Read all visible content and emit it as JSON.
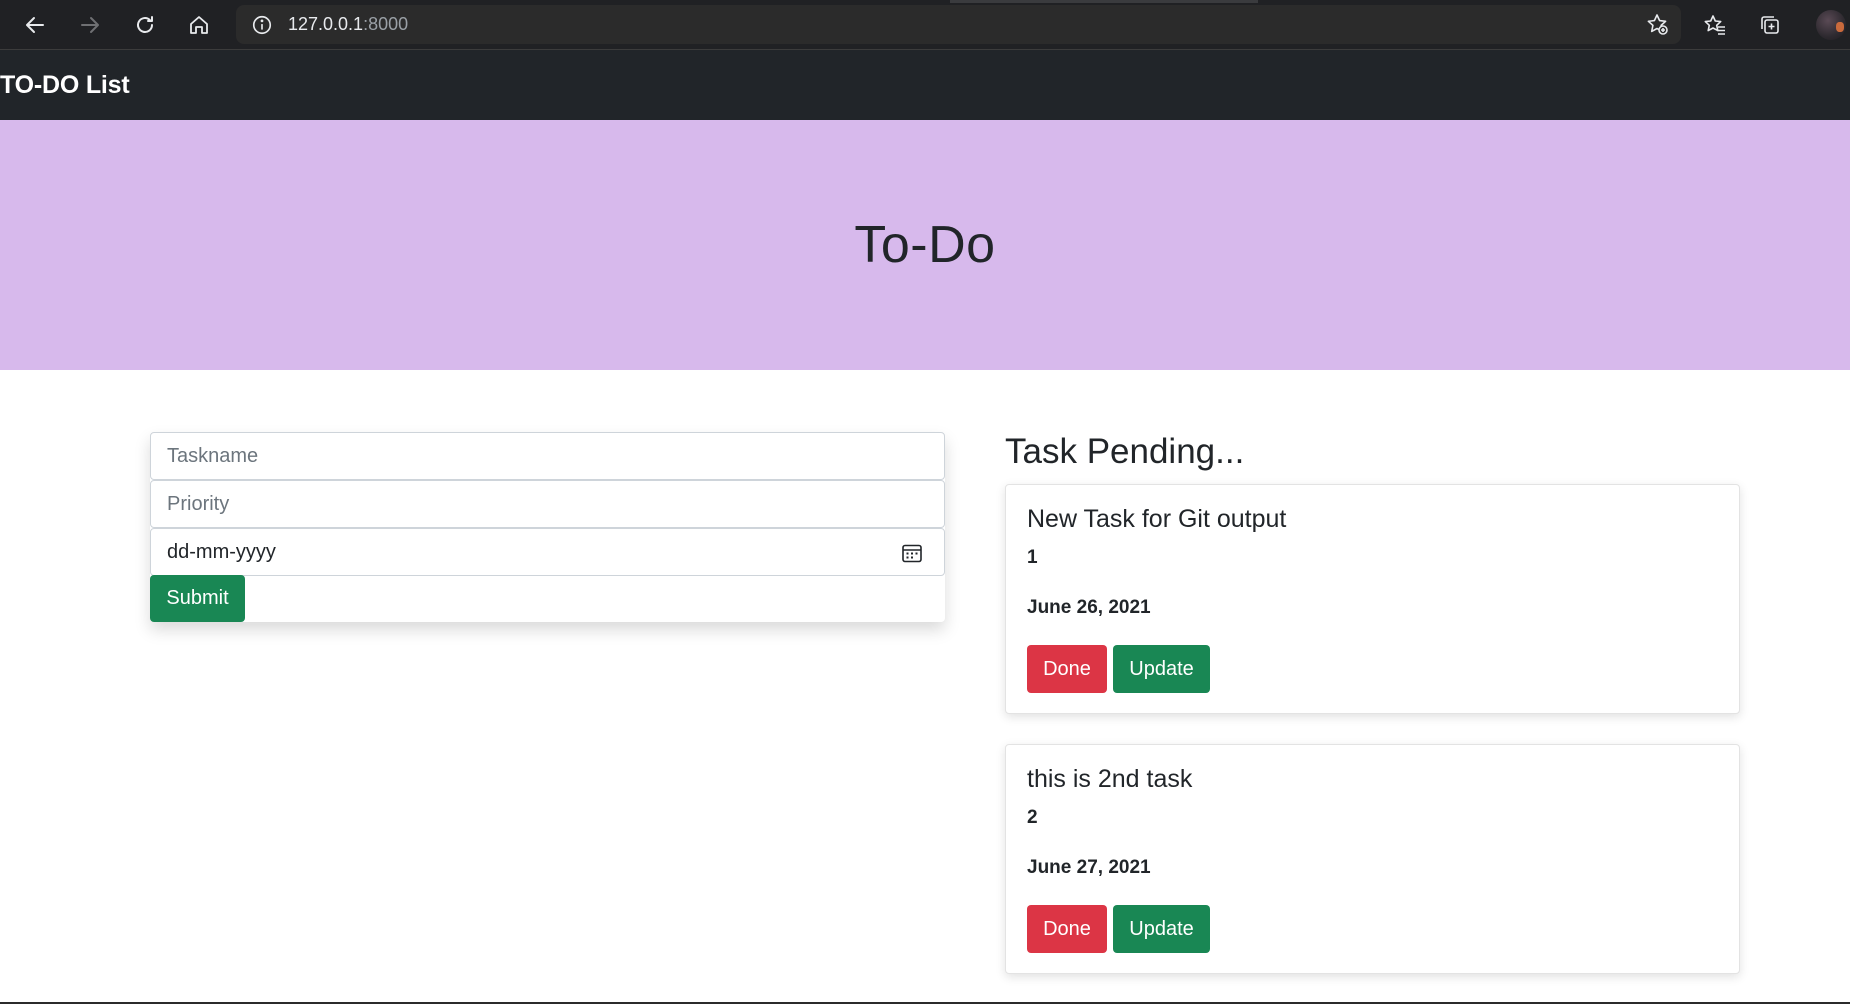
{
  "browser": {
    "url_host": "127.0.0.1",
    "url_port": ":8000"
  },
  "navbar": {
    "brand": "TO-DO List"
  },
  "hero": {
    "title": "To-Do"
  },
  "form": {
    "taskname_placeholder": "Taskname",
    "priority_placeholder": "Priority",
    "date_value": "dd-mm-yyyy",
    "submit_label": "Submit"
  },
  "tasks": {
    "heading": "Task Pending...",
    "items": [
      {
        "name": "New Task for Git output",
        "priority": "1",
        "date": "June 26, 2021",
        "done_label": "Done",
        "update_label": "Update"
      },
      {
        "name": "this is 2nd task",
        "priority": "2",
        "date": "June 27, 2021",
        "done_label": "Done",
        "update_label": "Update"
      }
    ]
  },
  "colors": {
    "navbar_bg": "#212529",
    "hero_bg": "#d7b9ec",
    "success": "#198754",
    "danger": "#dc3545"
  },
  "icons": {
    "back": "arrow-left-icon",
    "forward": "arrow-right-icon",
    "reload": "reload-icon",
    "home": "home-icon",
    "site_info": "info-icon",
    "add_favorite": "star-add-icon",
    "favorites": "favorites-icon",
    "collections": "collections-icon",
    "calendar": "calendar-icon"
  }
}
